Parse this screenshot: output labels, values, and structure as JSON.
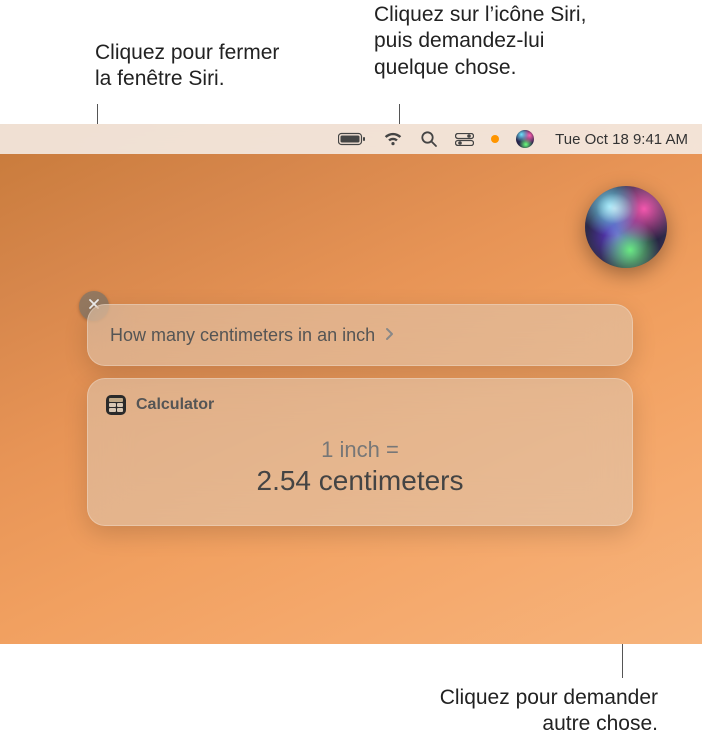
{
  "callouts": {
    "close": "Cliquez pour fermer\nla fenêtre Siri.",
    "siri_icon": "Cliquez sur l’icône Siri,\npuis demandez-lui\nquelque chose.",
    "ask_again": "Cliquez pour demander\nautre chose."
  },
  "menubar": {
    "datetime": "Tue Oct 18  9:41 AM"
  },
  "siri": {
    "query": "How many centimeters in an inch",
    "result": {
      "app": "Calculator",
      "from": "1 inch =",
      "to": "2.54 centimeters"
    }
  }
}
